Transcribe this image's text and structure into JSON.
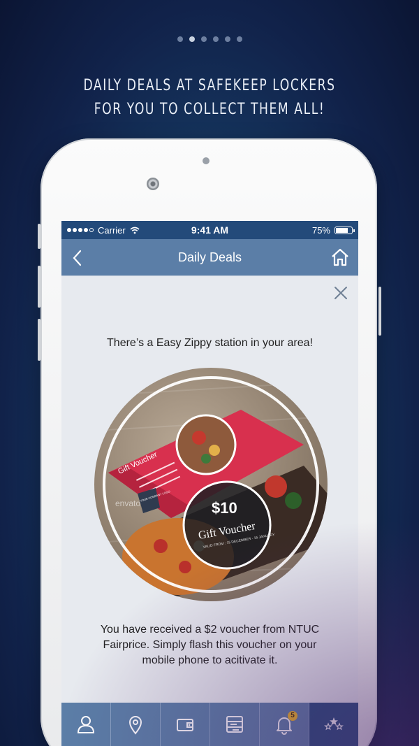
{
  "pager": {
    "total": 6,
    "active_index": 1
  },
  "headline": "Daily deals at Safekeep lockers for you to collect them all!",
  "status_bar": {
    "carrier": "Carrier",
    "time": "9:41 AM",
    "battery": "75%",
    "battery_level": 0.75
  },
  "nav": {
    "title": "Daily Deals",
    "back_icon": "chevron-left-icon",
    "home_icon": "home-icon"
  },
  "popup": {
    "close_icon": "close-icon",
    "message_top": "There’s a Easy Zippy station in your area!",
    "voucher": {
      "price": "$10",
      "title_1": "Gift Voucher",
      "title_2": "Gift Voucher",
      "valid": "VALID FROM : 15 DECEMBER - 15 JANUARY",
      "logo": "YOUR COMPANY LOGO",
      "watermark": "envato"
    },
    "message_bottom": "You have received a $2 voucher from NTUC Fairprice. Simply flash this voucher on your mobile phone to acitivate it."
  },
  "tabbar": {
    "tabs": [
      {
        "icon": "user-icon"
      },
      {
        "icon": "location-pin-icon"
      },
      {
        "icon": "wallet-icon"
      },
      {
        "icon": "locker-icon"
      },
      {
        "icon": "bell-icon",
        "badge": "5"
      },
      {
        "icon": "stars-icon",
        "active": true
      }
    ]
  },
  "colors": {
    "status_bar": "#234a7a",
    "nav_bar": "#5b7ea7",
    "screen_bg": "#e7eaef",
    "voucher_red": "#d8304e",
    "badge": "#f2b81f"
  }
}
